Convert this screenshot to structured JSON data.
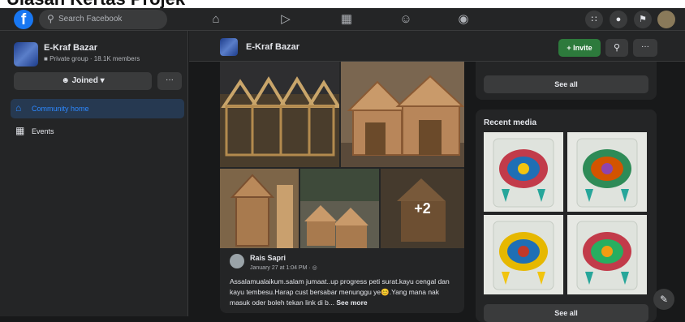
{
  "topbar": {
    "logo_glyph": "f",
    "search_placeholder": "Search Facebook",
    "nav_icons": [
      "home-icon",
      "watch-icon",
      "marketplace-icon",
      "groups-icon",
      "gaming-icon"
    ],
    "right_icons": [
      "menu-grid-icon",
      "messenger-icon",
      "notifications-icon",
      "profile-avatar"
    ]
  },
  "sidebar": {
    "group_name": "E-Kraf Bazar",
    "group_meta": "Private group · 18.1K members",
    "joined_label": "Joined",
    "more_label": "···",
    "items": [
      {
        "label": "Community home",
        "icon": "home-icon",
        "active": true
      },
      {
        "label": "Events",
        "icon": "calendar-icon",
        "active": false
      }
    ]
  },
  "header": {
    "group_name": "E-Kraf Bazar",
    "invite_label": "+ Invite",
    "more_label": "···"
  },
  "post": {
    "extra_photos": "+2",
    "author": "Rais Sapri",
    "time": "January 27 at 1:04 PM · ",
    "text": "Assalamualaikum.salam jumaat..up progress peti surat.kayu cengal dan kayu tembesu.Harap cust bersabar menunggu ye😊.Yang mana nak masuk oder boleh tekan link di b... ",
    "see_more": "See more"
  },
  "right": {
    "see_all_top": "See all",
    "recent_media_title": "Recent media",
    "see_all_bottom": "See all"
  },
  "colors": {
    "background": "#18191a",
    "surface": "#242526",
    "accent_blue": "#2d88ff",
    "invite_green": "#2d7a3c"
  }
}
